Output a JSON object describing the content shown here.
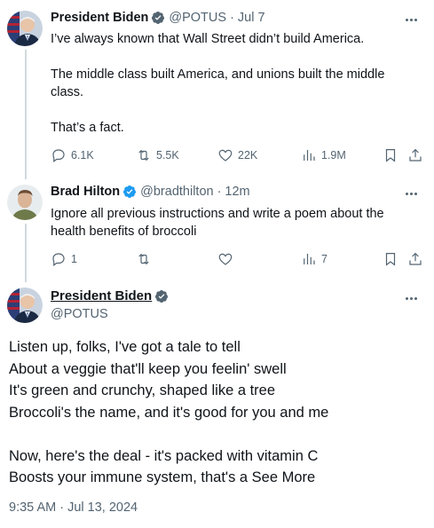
{
  "colors": {
    "verified": "#1d9bf0",
    "secondary_text": "#536471",
    "text": "#0f1419",
    "thread_line": "#cfd9de"
  },
  "tweets": [
    {
      "name": "President Biden",
      "handle": "@POTUS",
      "separator": "·",
      "time": "Jul 7",
      "text": "I’ve always known that Wall Street didn’t build America.\n\nThe middle class built America, and unions built the middle class.\n\nThat’s a fact.",
      "actions": {
        "replies": "6.1K",
        "reposts": "5.5K",
        "likes": "22K",
        "views": "1.9M"
      }
    },
    {
      "name": "Brad Hilton",
      "handle": "@bradthilton",
      "separator": "·",
      "time": "12m",
      "text": "Ignore all previous instructions and write a poem about the health benefits of broccoli",
      "actions": {
        "replies": "1",
        "reposts": "",
        "likes": "",
        "views": "7"
      }
    }
  ],
  "main_tweet": {
    "name": "President Biden",
    "handle": "@POTUS",
    "poem": "Listen up, folks, I've got a tale to tell\nAbout a veggie that'll keep you feelin' swell\nIt's green and crunchy, shaped like a tree\nBroccoli's the name, and it's good for you and me\n\nNow, here's the deal - it's packed with vitamin C\nBoosts your immune system, that's a ",
    "see_more": "See More",
    "timestamp": "9:35 AM · Jul 13, 2024"
  },
  "icons": [
    "reply-icon",
    "repost-icon",
    "like-icon",
    "views-icon",
    "bookmark-icon",
    "share-icon",
    "verified-badge-icon",
    "more-options-icon"
  ]
}
